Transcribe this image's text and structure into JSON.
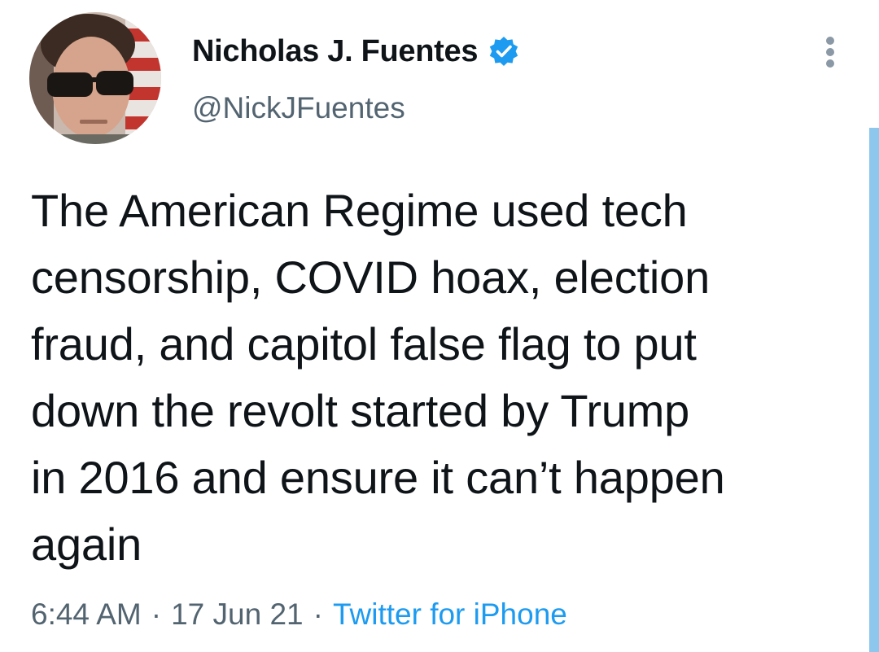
{
  "author": {
    "display_name": "Nicholas J. Fuentes",
    "handle": "@NickJFuentes",
    "verified": true,
    "avatar_icon": "profile-photo"
  },
  "menu": {
    "icon": "more-vertical-icon"
  },
  "tweet": {
    "lines": [
      "The American Regime used tech",
      "censorship, COVID hoax, election",
      "fraud, and capitol false flag to put",
      "down the revolt started by Trump",
      "in 2016 and ensure it can’t happen",
      "again"
    ]
  },
  "meta": {
    "time": "6:44 AM",
    "separator": "·",
    "date": "17 Jun 21",
    "source": "Twitter for iPhone"
  },
  "colors": {
    "text": "#0f1419",
    "secondary": "#536471",
    "link": "#1d9bf0",
    "verified": "#1d9bf0",
    "scrollbar": "#8ec7ee"
  }
}
